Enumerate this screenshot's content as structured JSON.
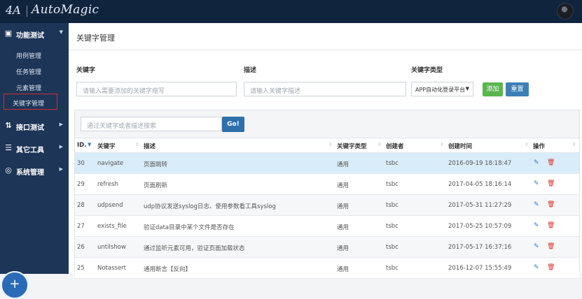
{
  "app": {
    "title": "AutoMagic",
    "logo_mark": "4A"
  },
  "sidebar": {
    "groups": [
      {
        "label": "功能测试",
        "icon": "screen-icon",
        "icon_glyph": "▣",
        "chevron": "▼"
      },
      {
        "label": "接口测试",
        "icon": "interface-icon",
        "icon_glyph": "⇅",
        "chevron": "▶"
      },
      {
        "label": "其它工具",
        "icon": "tools-icon",
        "icon_glyph": "☰",
        "chevron": "▶"
      },
      {
        "label": "系统管理",
        "icon": "settings-icon",
        "icon_glyph": "◎",
        "chevron": "▶"
      }
    ],
    "sub_items": [
      "用例管理",
      "任务管理",
      "元素管理",
      "关键字管理"
    ],
    "fab": "+"
  },
  "page": {
    "title": "关键字管理"
  },
  "form": {
    "keyword_label": "关键字",
    "keyword_placeholder": "请输入需要添加的关键字缩写",
    "desc_label": "描述",
    "desc_placeholder": "请输入关键字描述",
    "type_label": "关键字类型",
    "type_selected": "APP自动化登录平台",
    "add_label": "添加",
    "reset_label": "重置"
  },
  "search": {
    "placeholder": "通过关键字或者描述搜索",
    "go_label": "Go!"
  },
  "table": {
    "headers": {
      "id": "ID.",
      "keyword": "关键字",
      "desc": "描述",
      "type": "关键字类型",
      "creator": "创建者",
      "created": "创建时间",
      "actions": "操作"
    },
    "rows": [
      {
        "id": "30",
        "keyword": "navigate",
        "desc": "页面跳转",
        "type": "通用",
        "creator": "tsbc",
        "created": "2016-09-19 18:18:47"
      },
      {
        "id": "29",
        "keyword": "refresh",
        "desc": "页面刷新",
        "type": "通用",
        "creator": "tsbc",
        "created": "2017-04-05 18:16:14"
      },
      {
        "id": "28",
        "keyword": "udpsend",
        "desc": "udp协议发送syslog日志、使用参数看工具syslog",
        "type": "通用",
        "creator": "tsbc",
        "created": "2017-05-31 11:27:29"
      },
      {
        "id": "27",
        "keyword": "exists_file",
        "desc": "验证data目录中某个文件是否存在",
        "type": "通用",
        "creator": "tsbc",
        "created": "2017-05-25 10:57:09"
      },
      {
        "id": "26",
        "keyword": "untilshow",
        "desc": "通过监听元素可用，验证页面加载状态",
        "type": "通用",
        "creator": "tsbc",
        "created": "2017-05-17 16:37:16"
      },
      {
        "id": "25",
        "keyword": "Notassert",
        "desc": "通用断言【反向】",
        "type": "通用",
        "creator": "tsbc",
        "created": "2016-12-07 15:55:49"
      }
    ]
  },
  "colors": {
    "topbar": "#10243e",
    "sidebar": "#1d3557",
    "add_button": "#59b64e",
    "reset_button": "#3d7fb5",
    "selected_row": "#d9ecfa",
    "delete_icon": "#d93025",
    "edit_icon": "#2a7bd1"
  }
}
